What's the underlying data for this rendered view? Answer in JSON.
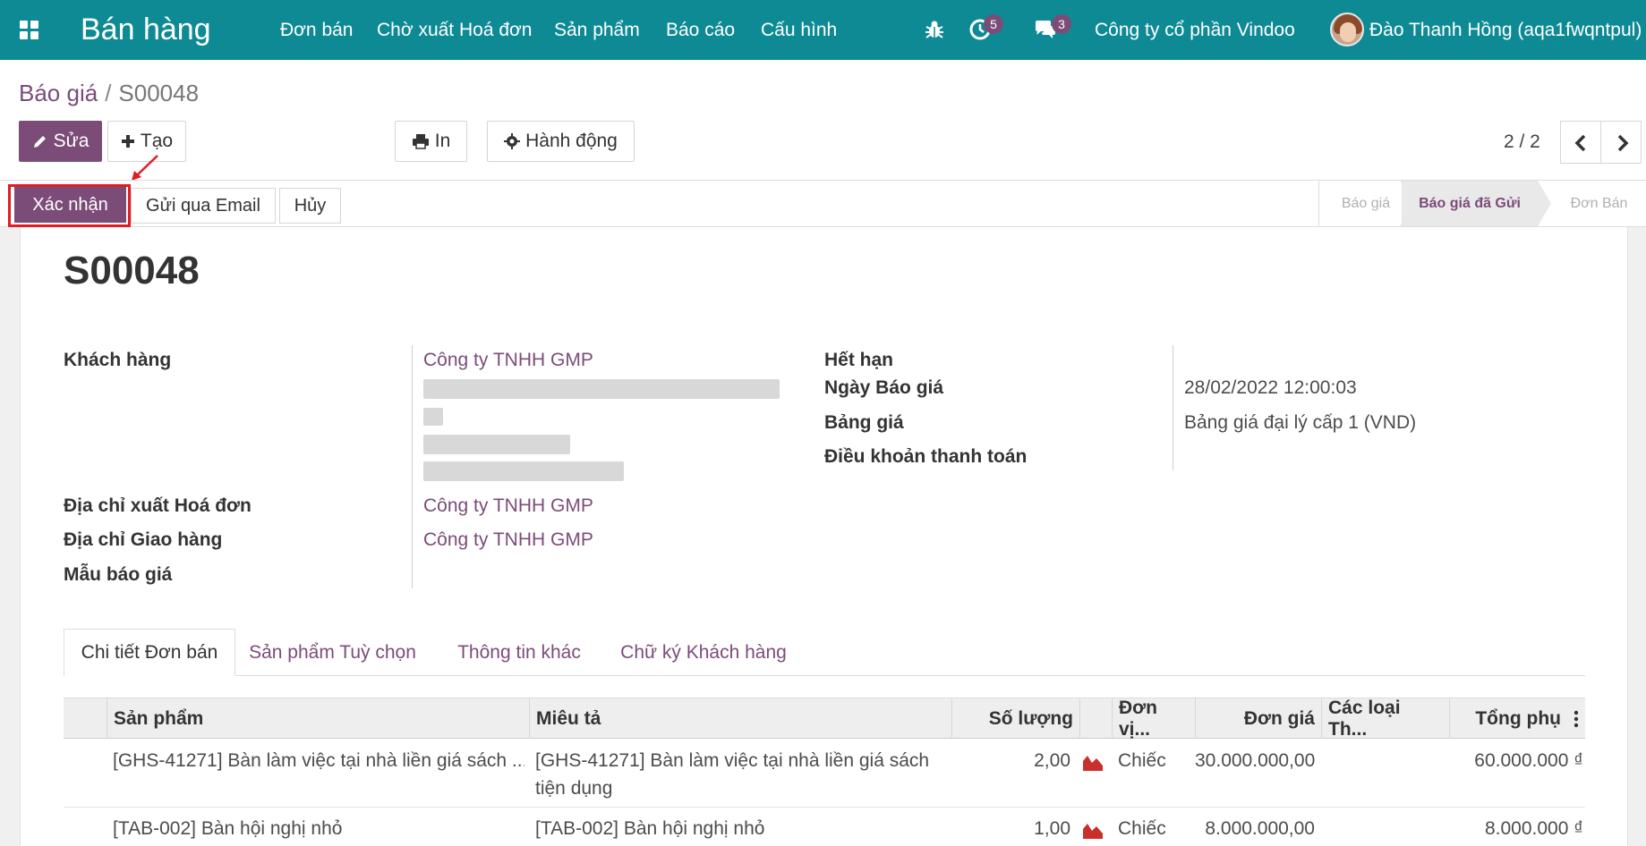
{
  "nav": {
    "brand": "Bán hàng",
    "menu": [
      "Đơn bán",
      "Chờ xuất Hoá đơn",
      "Sản phẩm",
      "Báo cáo",
      "Cấu hình"
    ],
    "activity_count": "5",
    "message_count": "3",
    "company": "Công ty cổ phần Vindoo",
    "user": "Đào Thanh Hồng (aqa1fwqntpul)"
  },
  "breadcrumb": {
    "parent": "Báo giá",
    "separator": "/",
    "current": "S00048"
  },
  "toolbar": {
    "edit_label": "Sửa",
    "create_label": "Tạo",
    "print_label": "In",
    "action_label": "Hành động",
    "pager": "2 / 2"
  },
  "statusbar": {
    "confirm_label": "Xác nhận",
    "email_label": "Gửi qua Email",
    "cancel_label": "Hủy",
    "stages": [
      "Báo giá",
      "Báo giá đã Gửi",
      "Đơn Bán"
    ],
    "active_stage": "Báo giá đã Gửi"
  },
  "form": {
    "name": "S00048",
    "customer_label": "Khách hàng",
    "customer_value": "Công ty TNHH GMP",
    "invoice_addr_label": "Địa chỉ xuất Hoá đơn",
    "invoice_addr_value": "Công ty TNHH GMP",
    "delivery_addr_label": "Địa chỉ Giao hàng",
    "delivery_addr_value": "Công ty TNHH GMP",
    "template_label": "Mẫu báo giá",
    "expiry_label": "Hết hạn",
    "date_label": "Ngày Báo giá",
    "date_value": "28/02/2022 12:00:03",
    "pricelist_label": "Bảng giá",
    "pricelist_value": "Bảng giá đại lý cấp 1 (VND)",
    "terms_label": "Điều khoản thanh toán"
  },
  "tabs": [
    "Chi tiết Đơn bán",
    "Sản phẩm Tuỳ chọn",
    "Thông tin khác",
    "Chữ ký Khách hàng"
  ],
  "table": {
    "headers": [
      "Sản phẩm",
      "Miêu tả",
      "Số lượng",
      "Đơn vị...",
      "Đơn giá",
      "Các loại Th...",
      "Tổng phụ"
    ],
    "rows": [
      {
        "product": "[GHS-41271] Bàn làm việc tại nhà liền giá sách ...",
        "desc1": "[GHS-41271] Bàn làm việc tại nhà liền giá sách",
        "desc2": "tiện dụng",
        "qty": "2,00",
        "uom": "Chiếc",
        "price": "30.000.000,00",
        "subtotal": "60.000.000 ₫"
      },
      {
        "product": "[TAB-002] Bàn hội nghị nhỏ",
        "desc1": "[TAB-002] Bàn hội nghị nhỏ",
        "desc2": "",
        "qty": "1,00",
        "uom": "Chiếc",
        "price": "8.000.000,00",
        "subtotal": "8.000.000 ₫"
      }
    ]
  }
}
